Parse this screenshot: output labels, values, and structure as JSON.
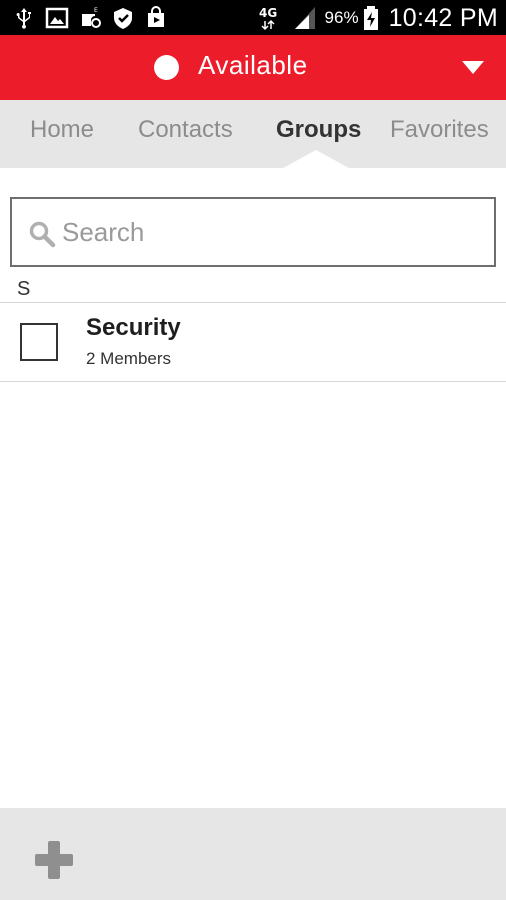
{
  "status_bar": {
    "left_icons": [
      "usb-icon",
      "image-icon",
      "voicemail-icon",
      "shield-icon",
      "play-store-icon"
    ],
    "network_label": "4G",
    "battery_percent": "96%",
    "time": "10:42 PM"
  },
  "presence": {
    "status_label": "Available",
    "dot_color": "#ffffff",
    "bar_color": "#ec1c2b"
  },
  "tabs": [
    {
      "label": "Home",
      "active": false
    },
    {
      "label": "Contacts",
      "active": false
    },
    {
      "label": "Groups",
      "active": true
    },
    {
      "label": "Favorites",
      "active": false
    }
  ],
  "search": {
    "placeholder": "Search",
    "value": ""
  },
  "groups": {
    "section_header": "S",
    "items": [
      {
        "name": "Security",
        "members": "2 Members",
        "checked": false
      }
    ]
  },
  "bottom_bar": {
    "add_icon": "plus-icon"
  }
}
